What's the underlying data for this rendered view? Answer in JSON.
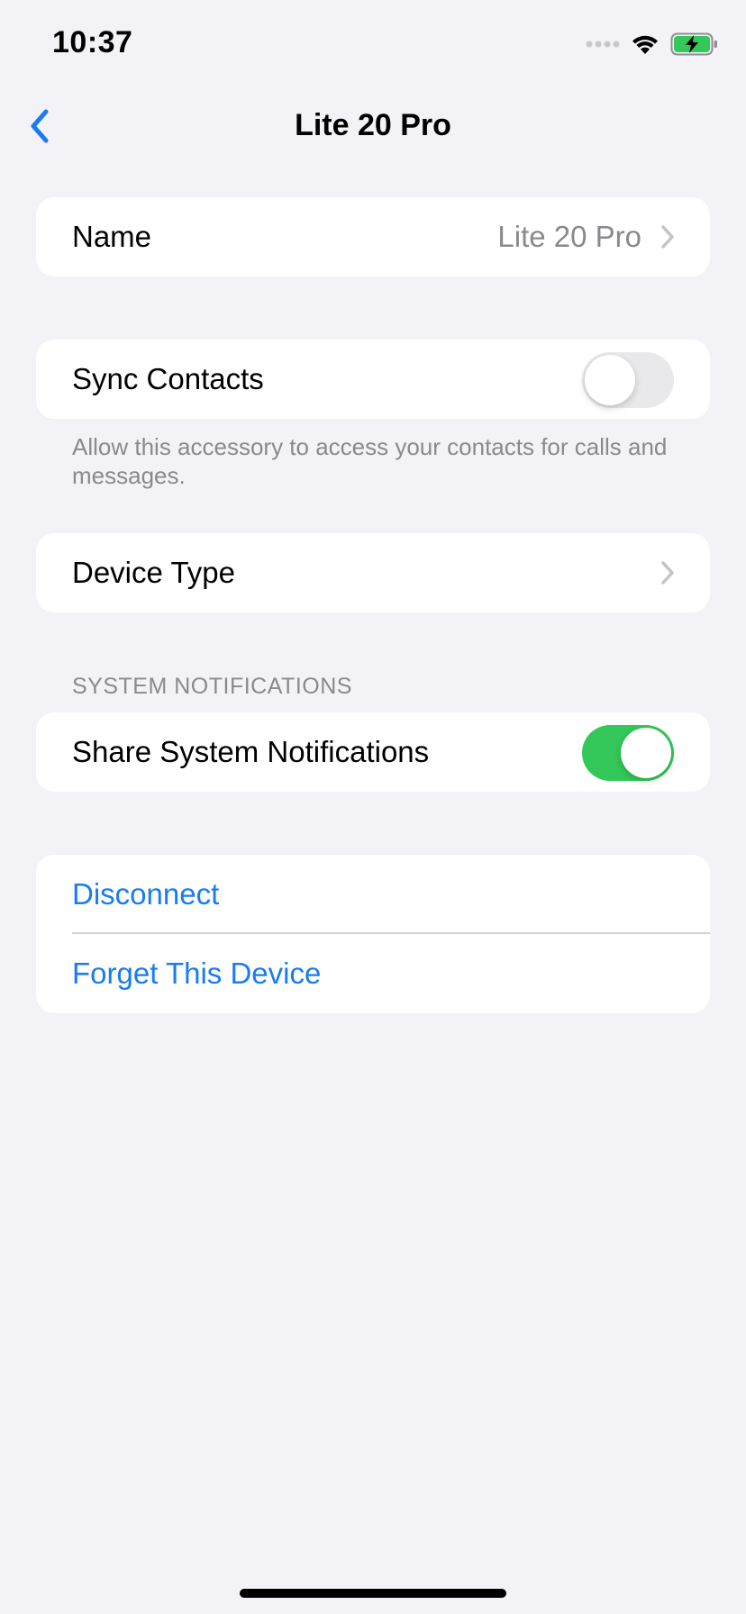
{
  "status_bar": {
    "time": "10:37",
    "icons": [
      "cellular-signal-icon",
      "wifi-icon",
      "battery-charging-icon"
    ]
  },
  "nav": {
    "back_icon": "chevron-left-icon",
    "title": "Lite 20 Pro"
  },
  "name_row": {
    "label": "Name",
    "value": "Lite 20 Pro"
  },
  "sync_contacts": {
    "label": "Sync Contacts",
    "enabled": false,
    "footnote": "Allow this accessory to access your contacts for calls and messages."
  },
  "device_type": {
    "label": "Device Type"
  },
  "system_notifications": {
    "header": "SYSTEM NOTIFICATIONS",
    "label": "Share System Notifications",
    "enabled": true
  },
  "actions": {
    "disconnect": "Disconnect",
    "forget": "Forget This Device"
  },
  "colors": {
    "accent": "#1a7cf0",
    "toggle_on": "#34c759",
    "background": "#f2f2f7"
  }
}
